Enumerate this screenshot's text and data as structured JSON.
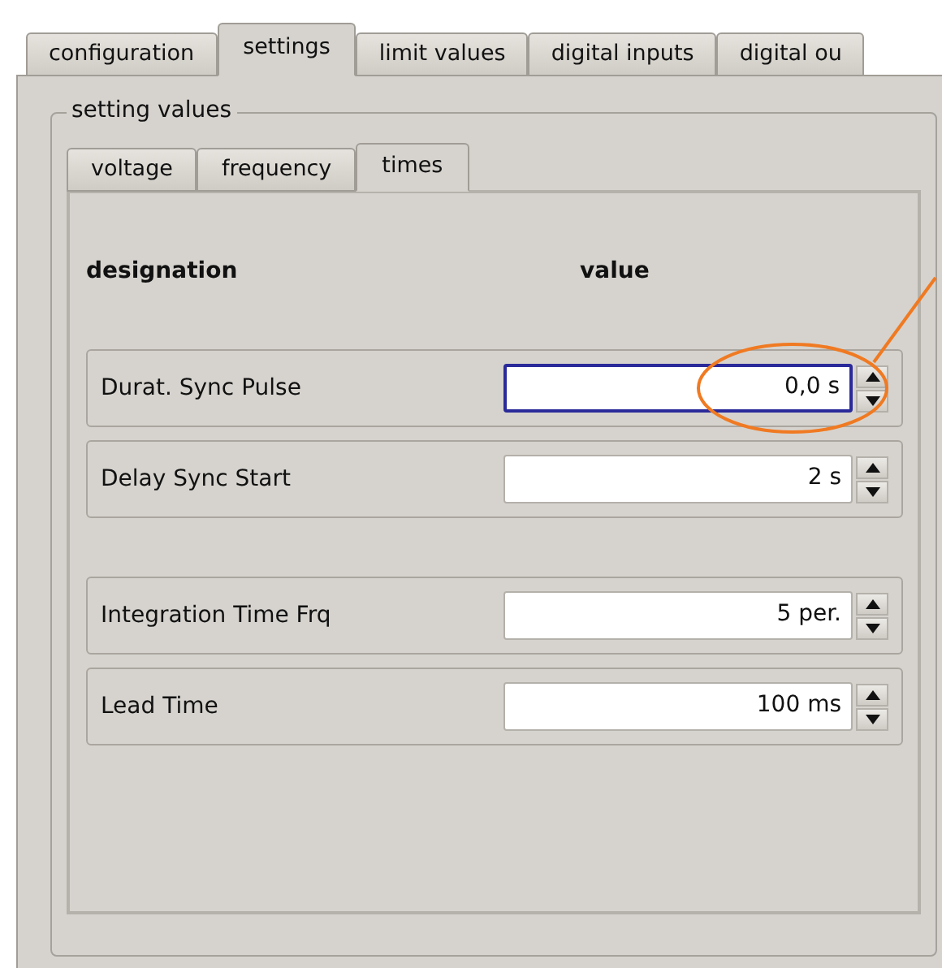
{
  "tabs": [
    {
      "label": "configuration",
      "selected": false
    },
    {
      "label": "settings",
      "selected": true
    },
    {
      "label": "limit values",
      "selected": false
    },
    {
      "label": "digital inputs",
      "selected": false
    },
    {
      "label": "digital ou",
      "selected": false
    }
  ],
  "group": {
    "title": "setting values",
    "tabs": [
      {
        "label": "voltage",
        "selected": false
      },
      {
        "label": "frequency",
        "selected": false
      },
      {
        "label": "times",
        "selected": true
      }
    ],
    "header": {
      "designation": "designation",
      "value": "value"
    },
    "sections": [
      {
        "rows": [
          {
            "label": "Durat. Sync Pulse",
            "value": "0,0 s",
            "focused": true,
            "highlighted": true
          },
          {
            "label": "Delay Sync Start",
            "value": "2 s",
            "focused": false,
            "highlighted": false
          }
        ]
      },
      {
        "rows": [
          {
            "label": "Integration Time Frq",
            "value": "5 per.",
            "focused": false,
            "highlighted": false
          },
          {
            "label": "Lead Time",
            "value": "100 ms",
            "focused": false,
            "highlighted": false
          }
        ]
      }
    ]
  }
}
